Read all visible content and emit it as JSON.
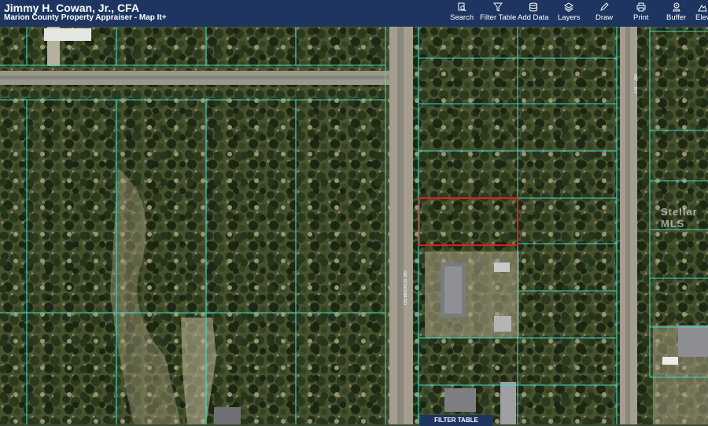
{
  "header": {
    "title": "Jimmy H. Cowan, Jr., CFA",
    "subtitle": "Marion County Property Appraiser - Map It+"
  },
  "toolbar": [
    {
      "label": "Search",
      "icon": "search-icon"
    },
    {
      "label": "Filter Table",
      "icon": "filter-icon"
    },
    {
      "label": "Add Data",
      "icon": "add-data-icon"
    },
    {
      "label": "Layers",
      "icon": "layers-icon"
    },
    {
      "label": "Draw",
      "icon": "draw-icon"
    },
    {
      "label": "Print",
      "icon": "print-icon"
    },
    {
      "label": "Buffer",
      "icon": "buffer-icon"
    },
    {
      "label": "Elev",
      "icon": "elevation-icon"
    }
  ],
  "map": {
    "road_label": "SW SONOMA RD",
    "road_label_east": "SW ... WY",
    "watermark": "Stellar MLS",
    "parcel_line_color": "#3fd9c6",
    "highlight_color": "#e02020"
  },
  "filter_button": "FILTER TABLE"
}
